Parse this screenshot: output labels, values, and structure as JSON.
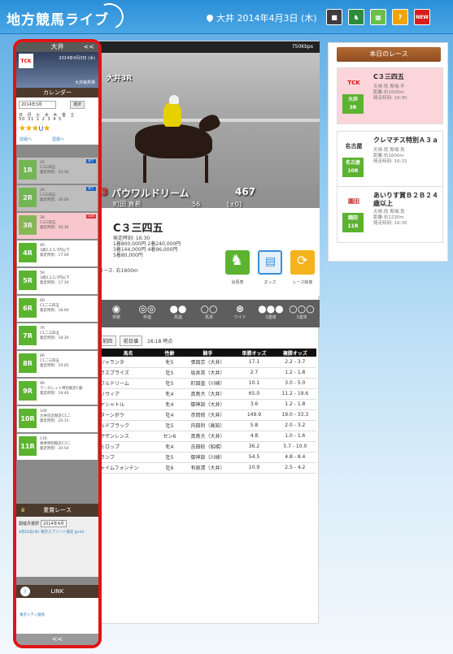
{
  "header": {
    "logo": "地方競馬ライブ",
    "location": "大井 2014年4月3日 (木)",
    "icons": [
      "film-icon",
      "horse-icon",
      "map-icon",
      "help-icon",
      "new-icon"
    ],
    "icon_labels": [
      "■",
      "♞",
      "▦",
      "?",
      "NEW"
    ]
  },
  "sidebar": {
    "venue": "大井",
    "collapse": "<<",
    "logo_text": "TCK",
    "date_line": "2014年4月3日 (木)",
    "venue_name": "大井競馬場",
    "calendar_title": "カレンダー",
    "month_value": "2014年3月",
    "month_button": "選択",
    "weekdays": "日 月 火 水 木 金 土",
    "days": "30 31 1  2  3  4  5",
    "prev": "前週へ",
    "next": "翌週へ",
    "races": [
      {
        "no": "1R",
        "line1": "1R",
        "line2": "C3三四五",
        "line3": "発走時刻：15:30",
        "state": "gray",
        "tag": "終了"
      },
      {
        "no": "2R",
        "line1": "2R",
        "line2": "C3三四五",
        "line3": "発走時刻：16:00",
        "state": "gray",
        "tag": "終了"
      },
      {
        "no": "3R",
        "line1": "3R",
        "line2": "C3三四五",
        "line3": "発走時刻：16:30",
        "state": "pink",
        "tag": "LIVE"
      },
      {
        "no": "4R",
        "line1": "4R",
        "line2": "3歳2,3,5,7円以下",
        "line3": "発走時刻：17:00",
        "state": "white",
        "tag": ""
      },
      {
        "no": "5R",
        "line1": "5R",
        "line2": "3歳2,3,5,7円以下",
        "line3": "発走時刻：17:30",
        "state": "white",
        "tag": ""
      },
      {
        "no": "6R",
        "line1": "6R",
        "line2": "C1二三四五",
        "line3": "発走時刻：18:00",
        "state": "white",
        "tag": ""
      },
      {
        "no": "7R",
        "line1": "7R",
        "line2": "C1二三四五",
        "line3": "発走時刻：18:30",
        "state": "white",
        "tag": ""
      },
      {
        "no": "8R",
        "line1": "8R",
        "line2": "C1二三四五",
        "line3": "発走時刻：19:05",
        "state": "white",
        "tag": ""
      },
      {
        "no": "9R",
        "line1": "9R",
        "line2": "マーガレット特別競走C級",
        "line3": "発走時刻：19:40",
        "state": "white",
        "tag": ""
      },
      {
        "no": "10R",
        "line1": "10R",
        "line2": "大井記念競走C1二",
        "line3": "発走時刻：20:15",
        "state": "white",
        "tag": ""
      },
      {
        "no": "11R",
        "line1": "11R",
        "line2": "春季特別競走C3二",
        "line3": "発走時刻：20:50",
        "state": "white",
        "tag": ""
      }
    ],
    "fav_title": "重賞レース",
    "fav_label": "開催月選択",
    "fav_value": "2014年4月",
    "fav_link": "4月10日(木) 東京スプリント競走 JpnIII",
    "link_title": "LINK",
    "link_item": "東京シティ競馬",
    "footer": "<<"
  },
  "video": {
    "bitrate": "750Kbps",
    "race_label": "大井3R",
    "horse_no": "3",
    "horse_name": "パウワルドリーム",
    "weight": "467",
    "weight_diff": "[±0]",
    "jockey": "町田 直希",
    "carry": "56"
  },
  "race_info": {
    "title": "C３三四五",
    "lines": [
      "発走時刻: 16:30",
      "1着800,000円 2着240,000円",
      "3着144,000円 4着96,000円",
      "5着80,000円"
    ],
    "course": "コース: 右1600m",
    "buttons": [
      "出馬表",
      "オッズ",
      "レース映像"
    ]
  },
  "bet_types": [
    {
      "glyph": "◉",
      "label": "単勝"
    },
    {
      "glyph": "◎◎",
      "label": "枠連"
    },
    {
      "glyph": "●●",
      "label": "馬連"
    },
    {
      "glyph": "○○",
      "label": "馬単"
    },
    {
      "glyph": "⊛",
      "label": "ワイド"
    },
    {
      "glyph": "●●●",
      "label": "3連複"
    },
    {
      "glyph": "○○○",
      "label": "3連単"
    }
  ],
  "tabs": {
    "tab1": "前回",
    "tab2": "前日値",
    "time": "16:18 時点"
  },
  "table": {
    "headers": [
      "馬名",
      "性齢",
      "騎手",
      "単勝オッズ",
      "複勝オッズ"
    ],
    "rows": [
      [
        "ジャランタ",
        "牝5",
        "張田京（大井）",
        "17.1",
        "2.2 - 3.7"
      ],
      [
        "ラスプライズ",
        "牡5",
        "坂井英（大井）",
        "2.7",
        "1.2 - 1.8"
      ],
      [
        "ワルドリーム",
        "牡5",
        "町田直（川崎）",
        "10.1",
        "3.0 - 5.0"
      ],
      [
        "リウィア",
        "牝4",
        "真島大（大井）",
        "65.0",
        "11.2 - 19.6"
      ],
      [
        "ヤシャトル",
        "牝4",
        "御神訓（大井）",
        "3.6",
        "1.2 - 1.8"
      ],
      [
        "ターンボウ",
        "牡4",
        "赤岡修（大井）",
        "149.9",
        "19.0 - 33.3"
      ],
      [
        "ルドブラック",
        "牡5",
        "内田利（高知）",
        "5.8",
        "2.0 - 3.2"
      ],
      [
        "サザンレンス",
        "セン6",
        "真島大（大井）",
        "4.8",
        "1.0 - 1.6"
      ],
      [
        "ミロップ",
        "牝4",
        "吉田稔（船橋）",
        "36.2",
        "5.7 - 10.0"
      ],
      [
        "ランブ",
        "牡5",
        "御神訓（川崎）",
        "54.5",
        "4.8 - 8.4"
      ],
      [
        "ャイムフォンテン",
        "牡6",
        "有原清（大井）",
        "10.9",
        "2.5 - 4.2"
      ]
    ]
  },
  "right_panel": {
    "header": "本日のレース",
    "cards": [
      {
        "logo": "TCK",
        "badge_line1": "大井",
        "badge_line2": "3R",
        "title": "C３三四五",
        "d1": "天候:雨 馬場:不",
        "d2": "距離:右1600m",
        "d3": "発走時刻: 16:30",
        "state": "pink"
      },
      {
        "logo": "名古屋",
        "badge_line1": "名古屋",
        "badge_line2": "10R",
        "title": "クレマチス特別Ａ３ａ",
        "d1": "天候:雨 馬場:良",
        "d2": "距離:右1600m",
        "d3": "発走時刻: 16:15",
        "state": "white"
      },
      {
        "logo": "園田",
        "badge_line1": "園田",
        "badge_line2": "11R",
        "title": "あいりす賞Ｂ２Ｂ２４歳以上",
        "d1": "天候:雨 馬場:良",
        "d2": "距離:右1230m",
        "d3": "発走時刻: 16:30",
        "state": "white"
      }
    ]
  },
  "colors": {
    "accent": "#5cb330",
    "highlight": "#e01414",
    "header": "#2b8fd6",
    "brown": "#8d4d1f"
  }
}
